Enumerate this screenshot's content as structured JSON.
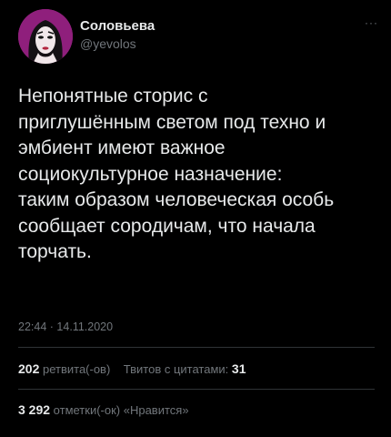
{
  "author": {
    "name": "Соловьева",
    "handle": "@yevolos",
    "avatar_icon": "profile-avatar"
  },
  "menu": {
    "more_icon": "ellipsis-icon",
    "more_glyph": "···"
  },
  "tweet": {
    "lines": [
      "Непонятные сторис с",
      "приглушённым светом под техно и",
      "эмбиент имеют важное",
      "социокультурное назначение:",
      "таким образом человеческая особь",
      "сообщает сородичам, что начала",
      "торчать."
    ],
    "time": "22:44",
    "separator": "·",
    "date": "14.11.2020"
  },
  "stats": {
    "retweets_count": "202",
    "retweets_label": "ретвита(-ов)",
    "quotes_label": "Твитов с цитатами:",
    "quotes_count": "31",
    "likes_count": "3 292",
    "likes_label": "отметки(-ок) «Нравится»"
  },
  "colors": {
    "background": "#000000",
    "primary_text": "#e7e9ea",
    "secondary_text": "#71767b",
    "divider": "#2f3336",
    "avatar_bg": "#8f1f7c"
  }
}
